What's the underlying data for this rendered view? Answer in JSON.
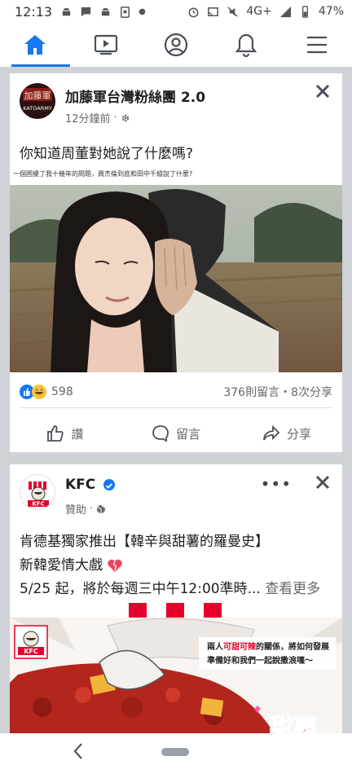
{
  "status_bar": {
    "time": "12:13",
    "network": "4G+",
    "battery": "47%"
  },
  "nav": {
    "items": [
      {
        "name": "home",
        "icon": "home-icon",
        "active": true
      },
      {
        "name": "watch",
        "icon": "video-icon",
        "active": false
      },
      {
        "name": "profile",
        "icon": "profile-icon",
        "active": false
      },
      {
        "name": "notifications",
        "icon": "bell-icon",
        "active": false
      },
      {
        "name": "menu",
        "icon": "hamburger-menu-icon",
        "active": false
      }
    ],
    "accent": "#1877f2"
  },
  "post1": {
    "page_name": "加藤軍台灣粉絲團 2.0",
    "avatar_text": "KATOARMY",
    "time": "12分鐘前",
    "text": "你知道周董對她說了什麼嗎?",
    "image_caption": "一個困擾了我十幾年的問題，周杰倫到底和田中千繪說了什麼?",
    "reactions_count": "598",
    "comments_shares": "376則留言・8次分享",
    "actions": {
      "like": "讚",
      "comment": "留言",
      "share": "分享"
    }
  },
  "post2": {
    "page_name": "KFC",
    "sponsored": "贊助",
    "line1": "肯德基獨家推出【韓辛與甜薯的羅曼史】",
    "line2": "新韓愛情大戲",
    "line3": "5/25 起，將於每週三中午12:00準時...",
    "see_more": "查看更多",
    "logo_text": "KFC",
    "ad_text1_a": "兩人",
    "ad_text1_b": "可甜可辣",
    "ad_text1_c": "的關係，將如何發展",
    "ad_text2": "準備好和我們一起說撒浪嘿～",
    "ad_title": "甜薯",
    "brand_red": "#e4002b"
  }
}
